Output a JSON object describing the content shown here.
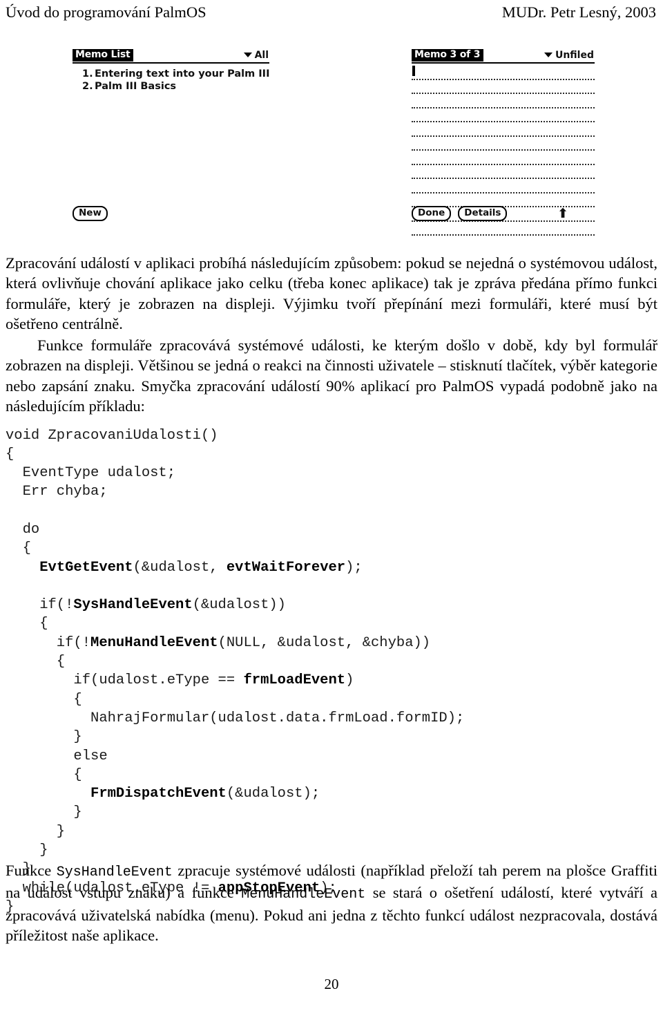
{
  "header": {
    "left": "Úvod do programování PalmOS",
    "right": "MUDr. Petr Lesný, 2003"
  },
  "figures": {
    "memo_list": {
      "title": "Memo List",
      "category": "All",
      "items": [
        {
          "number": "1.",
          "text": "Entering text into your Palm III"
        },
        {
          "number": "2.",
          "text": "Palm III Basics"
        }
      ],
      "buttons": [
        "New"
      ]
    },
    "memo_editor": {
      "title": "Memo 3 of 3",
      "category": "Unfiled",
      "line_count": 12,
      "buttons": [
        "Done",
        "Details"
      ],
      "up_arrow": "⬆"
    }
  },
  "paragraphs": {
    "p1": "Zpracování událostí v aplikaci probíhá následujícím způsobem: pokud se nejedná o systémovou událost, která ovlivňuje chování aplikace jako celku (třeba konec aplikace) tak je zpráva předána přímo funkci formuláře, který je zobrazen na displeji. Výjimku tvoří přepínání mezi formuláři, které musí být ošetřeno centrálně.",
    "p2": "Funkce formuláře zpracovává systémové události, ke kterým došlo v době, kdy byl formulář zobrazen na displeji. Většinou se jedná o reakci na činnosti uživatele – stisknutí tlačítek, výběr kategorie nebo zapsání znaku. Smyčka zpracování událostí 90% aplikací pro PalmOS vypadá podobně jako na následujícím příkladu:",
    "p3_a": "Funkce ",
    "p3_code1": "SysHandleEvent",
    "p3_b": " zpracuje systémové události (například přeloží tah perem na plošce Graffiti na událost vstupu znaku) a funkce ",
    "p3_code2": "MenuHandleEvent",
    "p3_c": " se stará o ošetření událostí, které vytváří a zpracovává uživatelská nabídka (menu). Pokud ani jedna z těchto funkcí událost nezpracovala, dostává příležitost naše aplikace."
  },
  "code_block": {
    "language": "C",
    "lines": [
      "void ZpracovaniUdalosti()",
      "{",
      "  EventType udalost;",
      "  Err chyba;",
      "",
      "  do",
      "  {",
      "    EvtGetEvent(&udalost, evtWaitForever);",
      "",
      "    if(!SysHandleEvent(&udalost))",
      "    {",
      "      if(!MenuHandleEvent(NULL, &udalost, &chyba))",
      "      {",
      "        if(udalost.eType == frmLoadEvent)",
      "        {",
      "          NahrajFormular(udalost.data.frmLoad.formID);",
      "        }",
      "        else",
      "        {",
      "          FrmDispatchEvent(&udalost);",
      "        }",
      "      }",
      "    }",
      "  }",
      "  while(udalost.eType != appStopEvent);",
      "}"
    ],
    "bold_tokens": [
      "EvtGetEvent",
      "evtWaitForever",
      "SysHandleEvent",
      "MenuHandleEvent",
      "frmLoadEvent",
      "FrmDispatchEvent",
      "appStopEvent"
    ]
  },
  "footer": {
    "page_number": "20"
  },
  "colors": {
    "text": "#000000",
    "code": "#1a1a1a",
    "background": "#ffffff"
  }
}
